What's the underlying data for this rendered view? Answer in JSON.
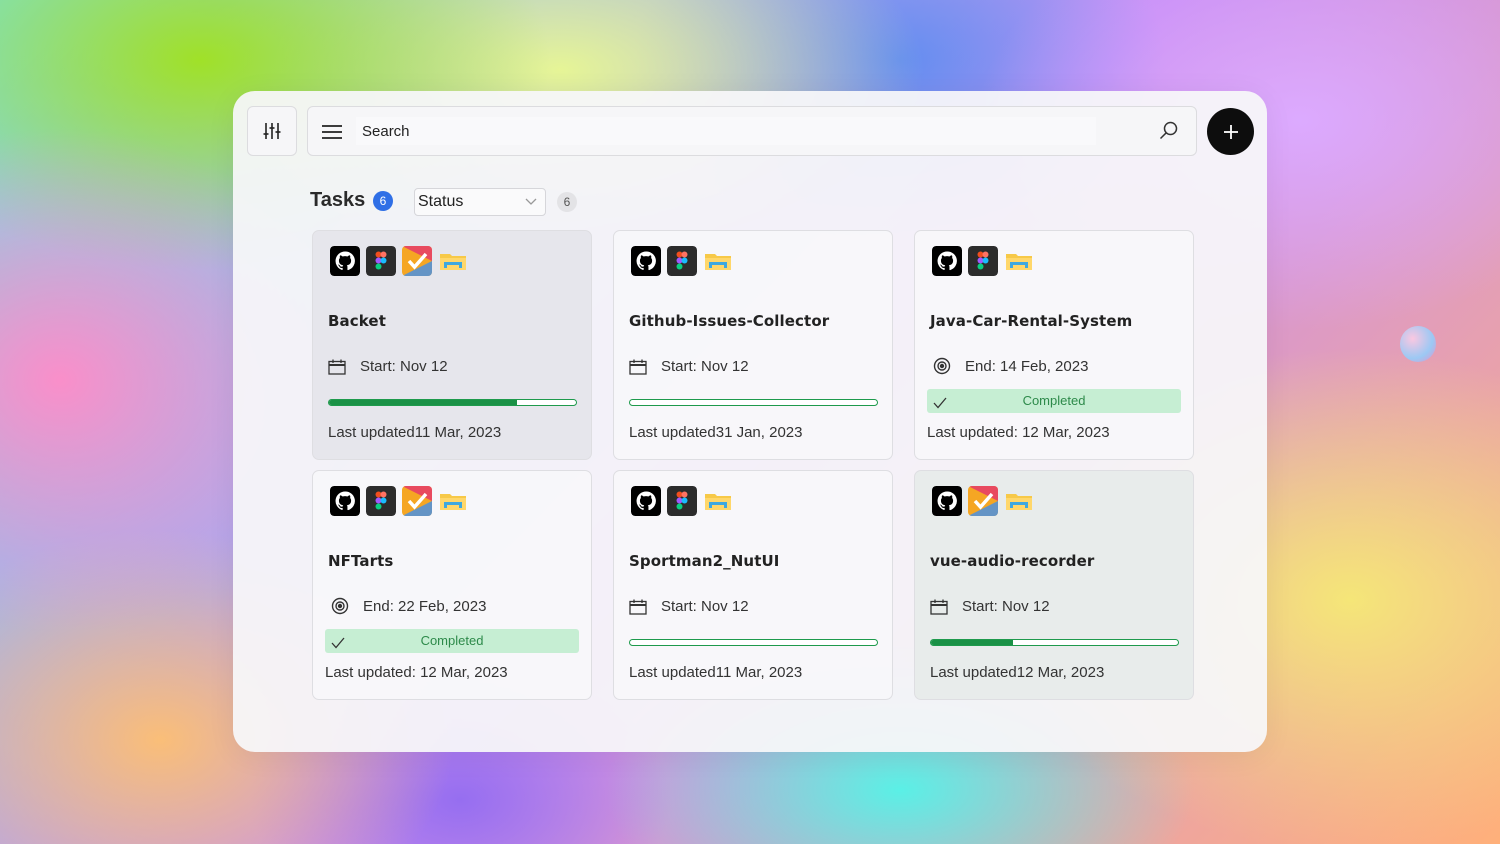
{
  "toolbar": {
    "search_placeholder": "Search",
    "filter_icon": "sliders-icon",
    "menu_icon": "hamburger-icon",
    "search_icon": "magnifier-icon",
    "add_icon": "plus-icon"
  },
  "header": {
    "title": "Tasks",
    "count": "6",
    "status_label": "Status",
    "status_count": "6"
  },
  "colors": {
    "accent": "#2f6fe6",
    "progress": "#1a9146",
    "completed_bg": "#c6eed3",
    "add_button": "#0d0d0d"
  },
  "tasks": [
    {
      "title": "Backet",
      "date_label": "Start: Nov 12",
      "date_icon": "calendar-icon",
      "progress": 0.76,
      "completed": false,
      "last_updated": "Last updated11 Mar, 2023",
      "apps": [
        "github",
        "figma",
        "todo",
        "folder"
      ]
    },
    {
      "title": "Github-Issues-Collector",
      "date_label": "Start: Nov 12",
      "date_icon": "calendar-icon",
      "progress": 0,
      "completed": false,
      "last_updated": "Last updated31 Jan, 2023",
      "apps": [
        "github",
        "figma",
        "folder"
      ]
    },
    {
      "title": "Java-Car-Rental-System",
      "date_label": "End: 14 Feb, 2023",
      "date_icon": "target-icon",
      "completed": true,
      "completed_label": "Completed",
      "last_updated": "Last updated: 12 Mar, 2023",
      "apps": [
        "github",
        "figma",
        "folder"
      ]
    },
    {
      "title": "NFTarts",
      "date_label": "End: 22 Feb, 2023",
      "date_icon": "target-icon",
      "completed": true,
      "completed_label": "Completed",
      "last_updated": "Last updated: 12 Mar, 2023",
      "apps": [
        "github",
        "figma",
        "todo",
        "folder"
      ]
    },
    {
      "title": "Sportman2_NutUI",
      "date_label": "Start: Nov 12",
      "date_icon": "calendar-icon",
      "progress": 0,
      "completed": false,
      "last_updated": "Last updated11 Mar, 2023",
      "apps": [
        "github",
        "figma",
        "folder"
      ]
    },
    {
      "title": "vue-audio-recorder",
      "date_label": "Start: Nov 12",
      "date_icon": "calendar-icon",
      "progress": 0.33,
      "completed": false,
      "last_updated": "Last updated12 Mar, 2023",
      "apps": [
        "github",
        "todo",
        "folder"
      ]
    }
  ]
}
